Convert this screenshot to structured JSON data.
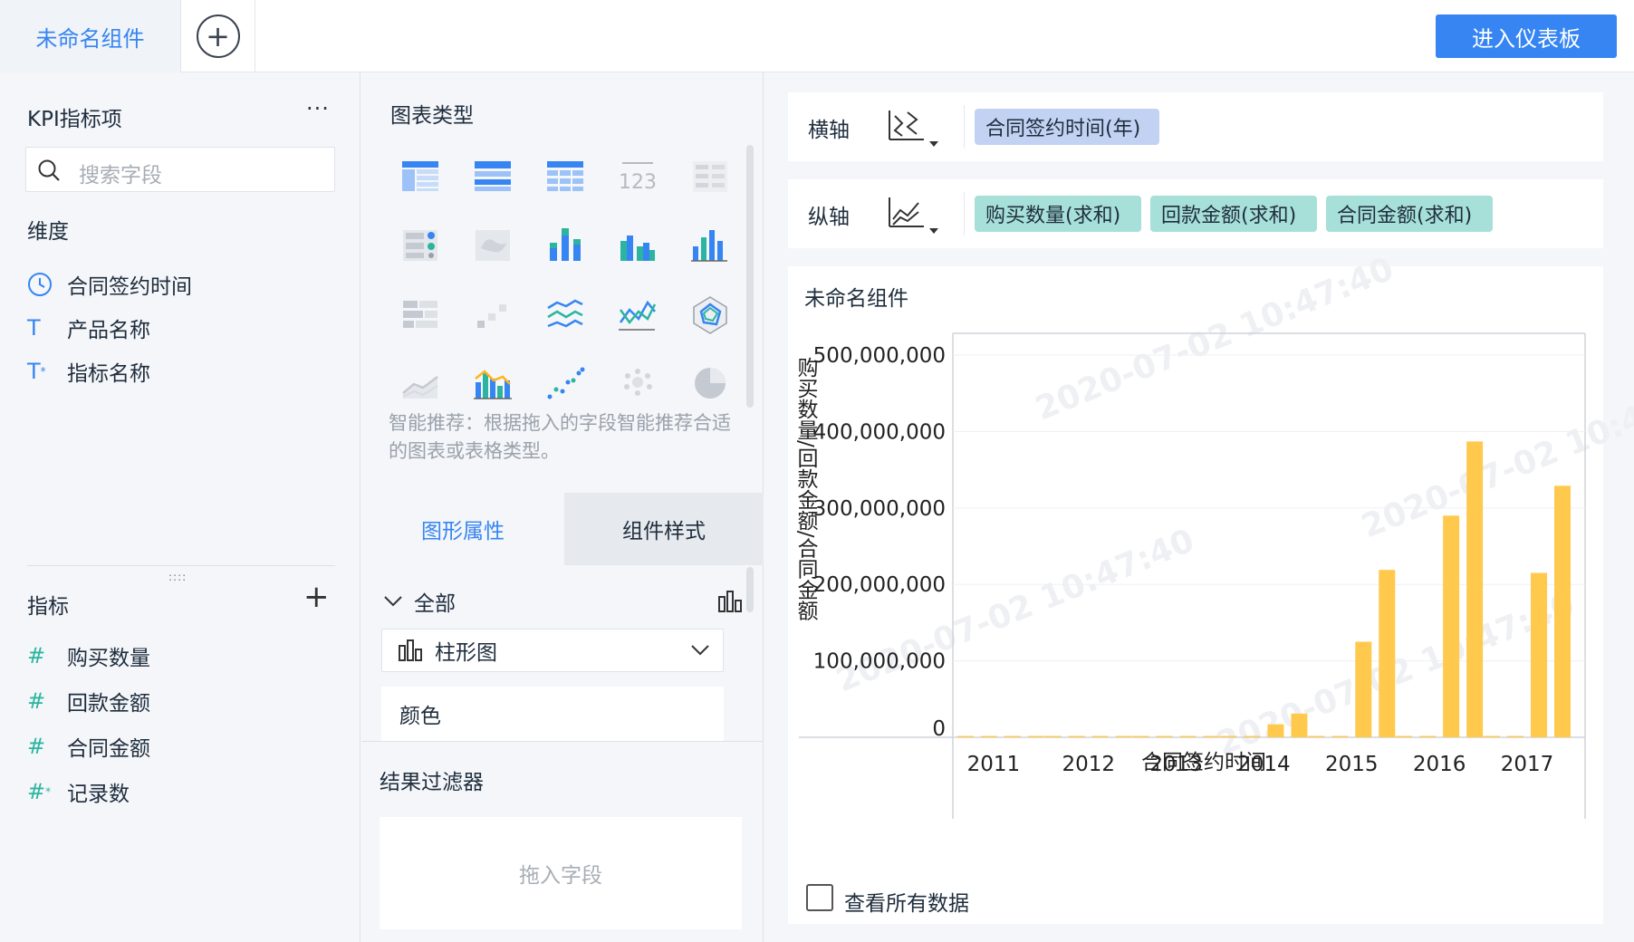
{
  "topbar": {
    "active_tab": "未命名组件",
    "add_icon": "plus-circle-icon",
    "enter_dashboard": "进入仪表板"
  },
  "left": {
    "kpi_title": "KPI指标项",
    "more": "···",
    "search_placeholder": "搜索字段",
    "dimension_label": "维度",
    "dimensions": [
      {
        "icon": "clock-icon",
        "label": "合同签约时间"
      },
      {
        "icon": "text-field-icon",
        "label": "产品名称"
      },
      {
        "icon": "text-field-star-icon",
        "label": "指标名称"
      }
    ],
    "metric_label": "指标",
    "metrics": [
      {
        "icon": "hash-icon",
        "label": "购买数量"
      },
      {
        "icon": "hash-icon",
        "label": "回款金额"
      },
      {
        "icon": "hash-icon",
        "label": "合同金额"
      },
      {
        "icon": "hash-star-icon",
        "label": "记录数"
      }
    ]
  },
  "middle": {
    "chart_types_title": "图表类型",
    "smart_hint": "智能推荐：根据拖入的字段智能推荐合适的图表或表格类型。",
    "tab_graphic": "图形属性",
    "tab_style": "组件样式",
    "all_label": "全部",
    "chart_select": "柱形图",
    "color_label": "颜色",
    "filter_title": "结果过滤器",
    "drop_hint": "拖入字段"
  },
  "right": {
    "x_axis_label": "横轴",
    "y_axis_label": "纵轴",
    "x_fields": [
      "合同签约时间(年)"
    ],
    "y_fields": [
      "购买数量(求和)",
      "回款金额(求和)",
      "合同金额(求和)"
    ],
    "panel_title": "未命名组件",
    "view_all": "查看所有数据",
    "watermark": "2020-07-02 10:47:40"
  },
  "colors": {
    "accent": "#3685f2",
    "bar": "#ffc94d",
    "pill_x": "#c2d2f2",
    "pill_y": "#a7e0d8"
  },
  "chart_data": {
    "type": "bar",
    "categories": [
      "2011",
      "2012",
      "2013",
      "2014",
      "2015",
      "2016",
      "2017"
    ],
    "series": [
      {
        "values": [
          300000,
          300000,
          200000,
          200000,
          200000,
          200000,
          200000
        ]
      },
      {
        "values": [
          300000,
          300000,
          300000,
          300000,
          200000,
          200000,
          200000
        ]
      },
      {
        "values": [
          300000,
          400000,
          300000,
          17000000,
          125000000,
          290000000,
          215000000
        ]
      },
      {
        "values": [
          400000,
          400000,
          300000,
          31000000,
          219000000,
          387000000,
          329000000
        ]
      }
    ],
    "yticks": [
      "500,000,000",
      "400,000,000",
      "300,000,000",
      "200,000,000",
      "100,000,000",
      "0"
    ],
    "ylabel": "购买数量/回款金额/合同金额",
    "xlabel": "合同签约时间",
    "ylim": [
      0,
      500000000
    ],
    "grid": true
  }
}
